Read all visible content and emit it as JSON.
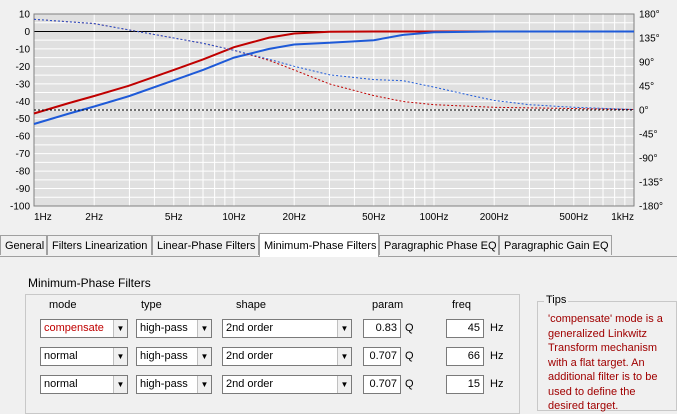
{
  "colors": {
    "plot_background": "#e0e0e0",
    "grid": "#ffffff",
    "red_curve": "#c00000",
    "blue_curve": "#1e5ad8",
    "tip_text": "#a00000"
  },
  "chart_data": {
    "type": "line",
    "xscale": "log",
    "xlim": [
      1,
      1000
    ],
    "ylim": [
      -100,
      10
    ],
    "y2lim": [
      -180,
      180
    ],
    "x_tick_labels": [
      "1Hz",
      "2Hz",
      "5Hz",
      "10Hz",
      "20Hz",
      "50Hz",
      "100Hz",
      "200Hz",
      "500Hz",
      "1kHz"
    ],
    "x_tick_values": [
      1,
      2,
      5,
      10,
      20,
      50,
      100,
      200,
      500,
      1000
    ],
    "y_tick_labels": [
      "10",
      "0",
      "-10",
      "-20",
      "-30",
      "-40",
      "-50",
      "-60",
      "-70",
      "-80",
      "-90",
      "-100"
    ],
    "y_tick_values": [
      10,
      0,
      -10,
      -20,
      -30,
      -40,
      -50,
      -60,
      -70,
      -80,
      -90,
      -100
    ],
    "y2_tick_labels": [
      "180°",
      "135°",
      "90°",
      "45°",
      "0°",
      "-45°",
      "-90°",
      "-135°",
      "-180°"
    ],
    "y2_tick_values": [
      180,
      135,
      90,
      45,
      0,
      -45,
      -90,
      -135,
      -180
    ],
    "grid": true,
    "series": [
      {
        "axis": "magnitude",
        "color": "#c00000",
        "dash": "solid",
        "x": [
          1,
          1.5,
          2,
          3,
          5,
          7,
          10,
          15,
          20,
          30,
          50,
          100,
          1000
        ],
        "y": [
          -47,
          -41,
          -37,
          -31,
          -22,
          -16,
          -9,
          -3.5,
          -1.2,
          -0.2,
          0,
          0,
          0
        ]
      },
      {
        "axis": "magnitude",
        "color": "#1e5ad8",
        "dash": "solid",
        "x": [
          1,
          1.5,
          2,
          3,
          5,
          7,
          10,
          15,
          20,
          30,
          50,
          70,
          100,
          200,
          1000
        ],
        "y": [
          -53,
          -47,
          -43,
          -37,
          -28,
          -22,
          -15,
          -10,
          -7.5,
          -6.5,
          -5,
          -2,
          -0.5,
          0,
          0
        ]
      },
      {
        "axis": "phase",
        "color": "#c00000",
        "dash": "dashed",
        "x": [
          1,
          2,
          3,
          5,
          7,
          10,
          15,
          20,
          30,
          50,
          70,
          100,
          200,
          1000
        ],
        "y": [
          170,
          162,
          150,
          135,
          125,
          112,
          93,
          75,
          49,
          27,
          16,
          10,
          5,
          1
        ]
      },
      {
        "axis": "phase",
        "color": "#1e5ad8",
        "dash": "dashed",
        "x": [
          1,
          2,
          3,
          5,
          7,
          10,
          15,
          20,
          30,
          50,
          70,
          100,
          150,
          200,
          300,
          500,
          1000
        ],
        "y": [
          170,
          162,
          150,
          135,
          125,
          112,
          95,
          82,
          66,
          57,
          55,
          43,
          28,
          18,
          10,
          5,
          1
        ]
      },
      {
        "axis": "phase",
        "color": "#000000",
        "dash": "dashed",
        "x": [
          1,
          1000
        ],
        "y": [
          0,
          0
        ]
      }
    ]
  },
  "tabs": [
    {
      "label": "General",
      "active": false
    },
    {
      "label": "Filters Linearization",
      "active": false
    },
    {
      "label": "Linear-Phase Filters",
      "active": false
    },
    {
      "label": "Minimum-Phase Filters",
      "active": true
    },
    {
      "label": "Paragraphic Phase EQ",
      "active": false
    },
    {
      "label": "Paragraphic Gain EQ",
      "active": false
    }
  ],
  "section": {
    "title": "Minimum-Phase Filters",
    "headers": {
      "mode": "mode",
      "type": "type",
      "shape": "shape",
      "param": "param",
      "freq": "freq"
    },
    "rows": [
      {
        "mode": "compensate",
        "type": "high-pass",
        "shape": "2nd order",
        "param": "0.83",
        "param_unit": "Q",
        "freq": "45",
        "freq_unit": "Hz"
      },
      {
        "mode": "normal",
        "type": "high-pass",
        "shape": "2nd order",
        "param": "0.707",
        "param_unit": "Q",
        "freq": "66",
        "freq_unit": "Hz"
      },
      {
        "mode": "normal",
        "type": "high-pass",
        "shape": "2nd order",
        "param": "0.707",
        "param_unit": "Q",
        "freq": "15",
        "freq_unit": "Hz"
      }
    ]
  },
  "tips": {
    "title": "Tips",
    "lines": [
      "'compensate' mode is a",
      "generalized Linkwitz",
      "Transform mechanism",
      "with a flat target. An",
      "additional filter is to be",
      "used to define the",
      "desired target."
    ]
  }
}
